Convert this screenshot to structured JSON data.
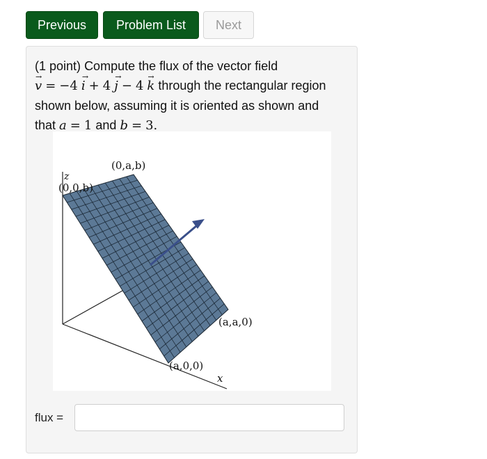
{
  "nav": {
    "previous": "Previous",
    "problem_list": "Problem List",
    "next": "Next"
  },
  "problem": {
    "points": "(1 point)",
    "text_lead": "Compute the flux of the vector field",
    "v": "v",
    "eq": "=",
    "coef_i": "−4",
    "i": "i",
    "plus": "+",
    "coef_j": "4",
    "j": "j",
    "minus": "−",
    "coef_k": "4",
    "k": "k",
    "text_region": "through the rectangular region",
    "text_oriented": "shown below, assuming it is oriented as shown and",
    "that": "that",
    "a": "a",
    "a_val": "1",
    "and": "and",
    "b": "b",
    "b_val": "3."
  },
  "figure": {
    "label_0ab": "(0,a,b)",
    "label_z": "z",
    "label_00b": "(0,0,b)",
    "label_aa0": "(a,a,0)",
    "label_a00": "(a,0,0)",
    "label_x": "x",
    "surface_color": "#5c7996",
    "arrow_color": "#3a4f8a"
  },
  "answer": {
    "label": "flux =",
    "value": "",
    "placeholder": ""
  }
}
